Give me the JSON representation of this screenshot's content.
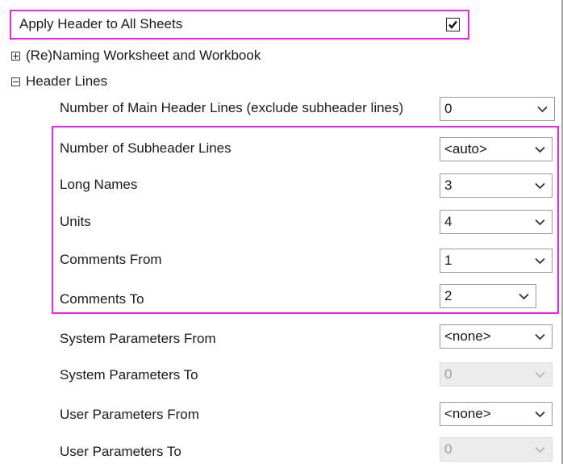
{
  "apply_header": {
    "label": "Apply Header to All Sheets",
    "checked": true
  },
  "groups": [
    {
      "label": "(Re)Naming Worksheet and Workbook",
      "state": "collapsed"
    },
    {
      "label": "Header Lines",
      "state": "expanded"
    }
  ],
  "rows": [
    {
      "label": "Number of Main Header Lines (exclude subheader lines)",
      "value": "0",
      "disabled": false
    },
    {
      "label": "Number of Subheader Lines",
      "value": "<auto>",
      "disabled": false
    },
    {
      "label": "Long Names",
      "value": "3",
      "disabled": false
    },
    {
      "label": "Units",
      "value": "4",
      "disabled": false
    },
    {
      "label": "Comments From",
      "value": "1",
      "disabled": false
    },
    {
      "label": "Comments To",
      "value": "2",
      "disabled": false
    },
    {
      "label": "System Parameters From",
      "value": "<none>",
      "disabled": false
    },
    {
      "label": "System Parameters To",
      "value": "0",
      "disabled": true
    },
    {
      "label": "User Parameters From",
      "value": "<none>",
      "disabled": false
    },
    {
      "label": "User Parameters To",
      "value": "0",
      "disabled": true
    }
  ],
  "colors": {
    "highlight": "#ee22ee",
    "disabled_bg": "#ececec",
    "text": "#1a1a1a"
  }
}
